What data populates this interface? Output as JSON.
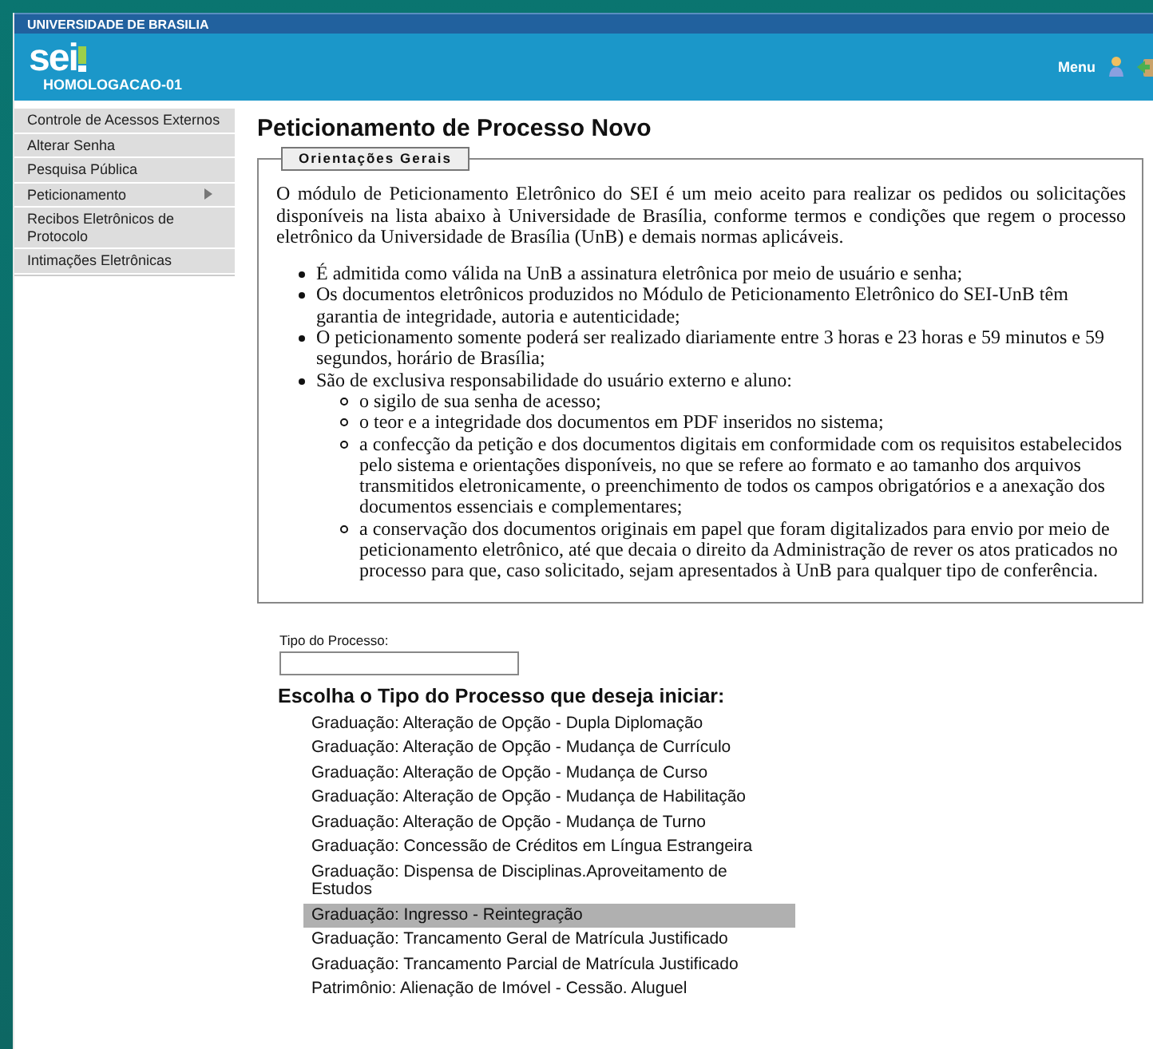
{
  "header": {
    "institution": "UNIVERSIDADE DE BRASILIA",
    "logo": "sei",
    "environment": "HOMOLOGACAO-01",
    "menu": "Menu"
  },
  "sidebar": {
    "items": [
      {
        "label": "Controle de Acessos Externos",
        "has_submenu": false
      },
      {
        "label": "Alterar Senha",
        "has_submenu": false
      },
      {
        "label": "Pesquisa Pública",
        "has_submenu": false
      },
      {
        "label": "Peticionamento",
        "has_submenu": true
      },
      {
        "label": "Recibos Eletrônicos de Protocolo",
        "has_submenu": false
      },
      {
        "label": "Intimações Eletrônicas",
        "has_submenu": false
      }
    ]
  },
  "page_title": "Peticionamento de Processo Novo",
  "guidelines": {
    "legend": "Orientações Gerais",
    "intro": "O módulo de Peticionamento Eletrônico do SEI é um meio aceito para realizar os pedidos ou solicitações disponíveis na lista abaixo à Universidade de Brasília, conforme termos e condições que regem o processo eletrônico da Universidade de Brasília (UnB) e demais normas aplicáveis.",
    "bullets": [
      {
        "text": "É admitida como válida na UnB a assinatura eletrônica por meio de usuário e senha;"
      },
      {
        "text": "Os documentos eletrônicos produzidos no Módulo de Peticionamento Eletrônico do SEI-UnB têm garantia de integridade, autoria e autenticidade;"
      },
      {
        "text": "O peticionamento somente poderá ser realizado diariamente entre 3 horas e 23 horas e 59 minutos e 59 segundos, horário de Brasília;"
      },
      {
        "text": "São de exclusiva responsabilidade do usuário externo e aluno:",
        "children": [
          {
            "text": "o sigilo de sua senha de acesso;"
          },
          {
            "text": "o teor e a integridade dos documentos em PDF inseridos no sistema;"
          },
          {
            "text": "a confecção da petição e dos documentos digitais em conformidade com os requisitos estabelecidos pelo sistema e orientações disponíveis, no que se refere ao formato e ao tamanho dos arquivos transmitidos eletronicamente, o preenchimento de todos os campos obrigatórios e a anexação dos documentos essenciais e complementares;"
          },
          {
            "text": "a conservação dos documentos originais em papel que foram digitalizados para envio por meio de peticionamento eletrônico, até que decaia o direito da Administração de rever os atos praticados no processo para que, caso solicitado, sejam apresentados à UnB para qualquer tipo de conferência."
          }
        ]
      }
    ]
  },
  "process_filter": {
    "label": "Tipo do Processo:"
  },
  "process_list": {
    "heading": "Escolha o Tipo do Processo que deseja iniciar:",
    "items": [
      {
        "label": "Graduação: Alteração de Opção - Dupla Diplomação",
        "selected": false
      },
      {
        "label": "Graduação: Alteração de Opção - Mudança de Currículo",
        "selected": false
      },
      {
        "label": "Graduação: Alteração de Opção - Mudança de Curso",
        "selected": false
      },
      {
        "label": "Graduação: Alteração de Opção - Mudança de Habilitação",
        "selected": false
      },
      {
        "label": "Graduação: Alteração de Opção - Mudança de Turno",
        "selected": false
      },
      {
        "label": "Graduação: Concessão de Créditos em Língua Estrangeira",
        "selected": false
      },
      {
        "label": "Graduação: Dispensa de Disciplinas.Aproveitamento de Estudos",
        "selected": false
      },
      {
        "label": "Graduação: Ingresso - Reintegração",
        "selected": true
      },
      {
        "label": "Graduação: Trancamento Geral de Matrícula Justificado",
        "selected": false
      },
      {
        "label": "Graduação: Trancamento Parcial de Matrícula Justificado",
        "selected": false
      },
      {
        "label": "Patrimônio: Alienação de Imóvel - Cessão. Aluguel",
        "selected": false
      }
    ]
  }
}
